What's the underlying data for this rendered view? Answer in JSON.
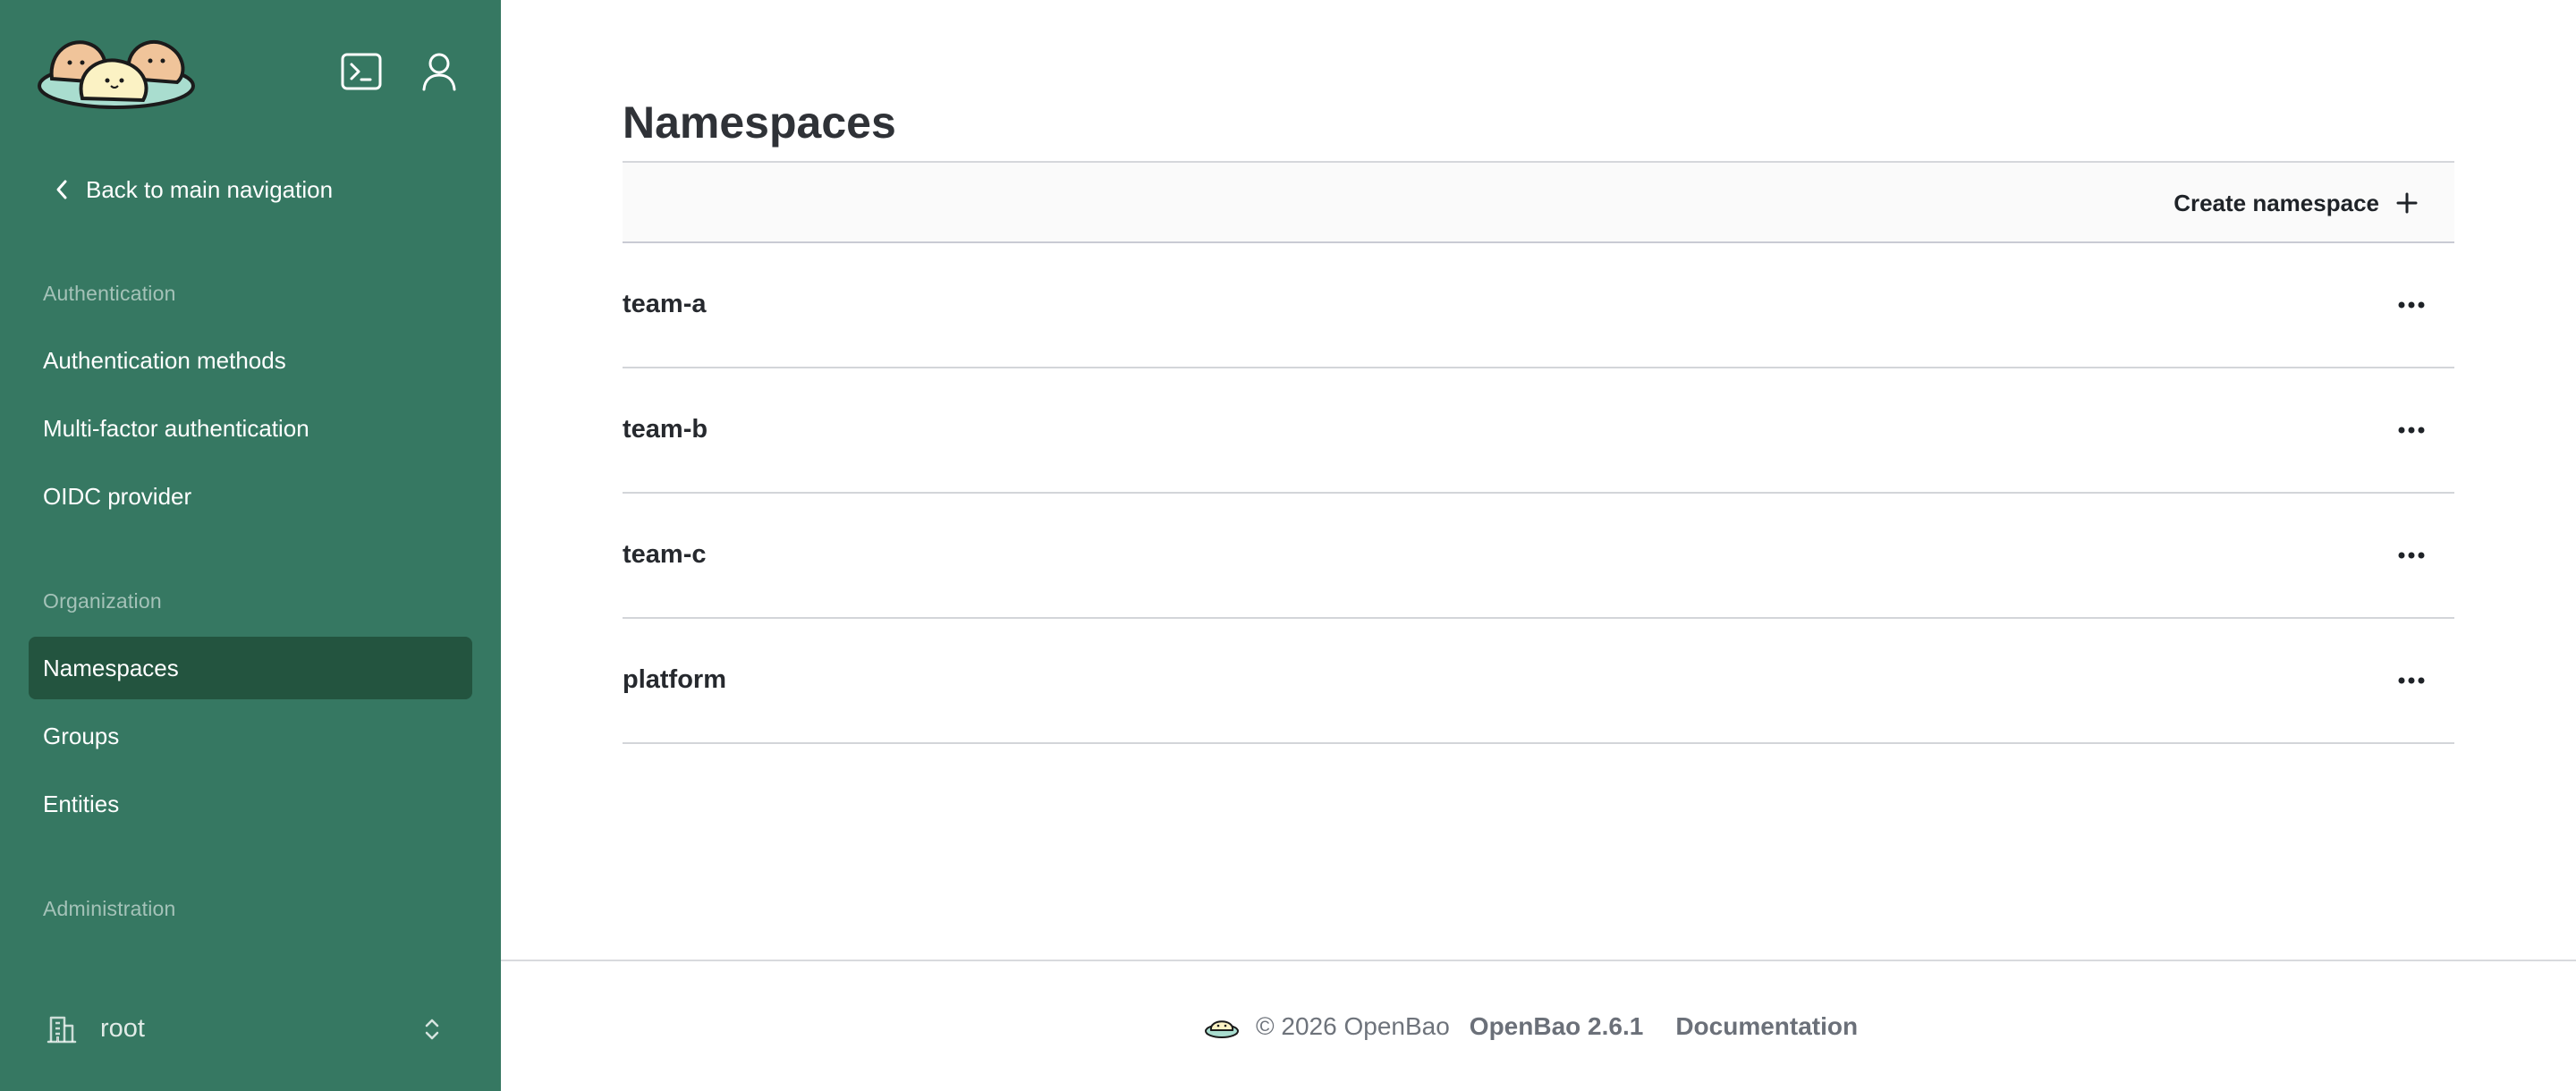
{
  "sidebar": {
    "logo_icon": "openbao-bao-logo",
    "console_icon": "terminal-icon",
    "user_icon": "user-icon",
    "back_label": "Back to main navigation",
    "sections": [
      {
        "label": "Authentication",
        "items": [
          "Authentication methods",
          "Multi-factor authentication",
          "OIDC provider"
        ]
      },
      {
        "label": "Organization",
        "items": [
          "Namespaces",
          "Groups",
          "Entities"
        ]
      },
      {
        "label": "Administration",
        "items": []
      }
    ],
    "active_item": "Namespaces",
    "namespace_picker": {
      "value": "root",
      "icon": "building-icon",
      "toggle_icon": "chevron-up-down-icon"
    }
  },
  "main": {
    "title": "Namespaces",
    "create_label": "Create namespace",
    "namespaces": [
      "team-a",
      "team-b",
      "team-c",
      "platform"
    ]
  },
  "footer": {
    "copyright": "© 2026 OpenBao",
    "version": "OpenBao 2.6.1",
    "docs_label": "Documentation"
  },
  "colors": {
    "sidebar_bg": "#367862",
    "sidebar_active": "#23543f",
    "toolbar_bg": "#fafafa"
  }
}
